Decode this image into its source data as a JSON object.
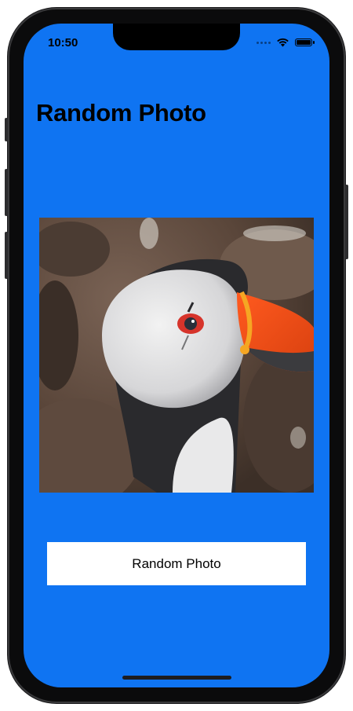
{
  "status_bar": {
    "time": "10:50"
  },
  "header": {
    "title": "Random Photo"
  },
  "photo": {
    "subject": "puffin"
  },
  "actions": {
    "random_button_label": "Random Photo"
  },
  "colors": {
    "background": "#0f74f2",
    "button": "#ffffff",
    "text": "#000000"
  }
}
